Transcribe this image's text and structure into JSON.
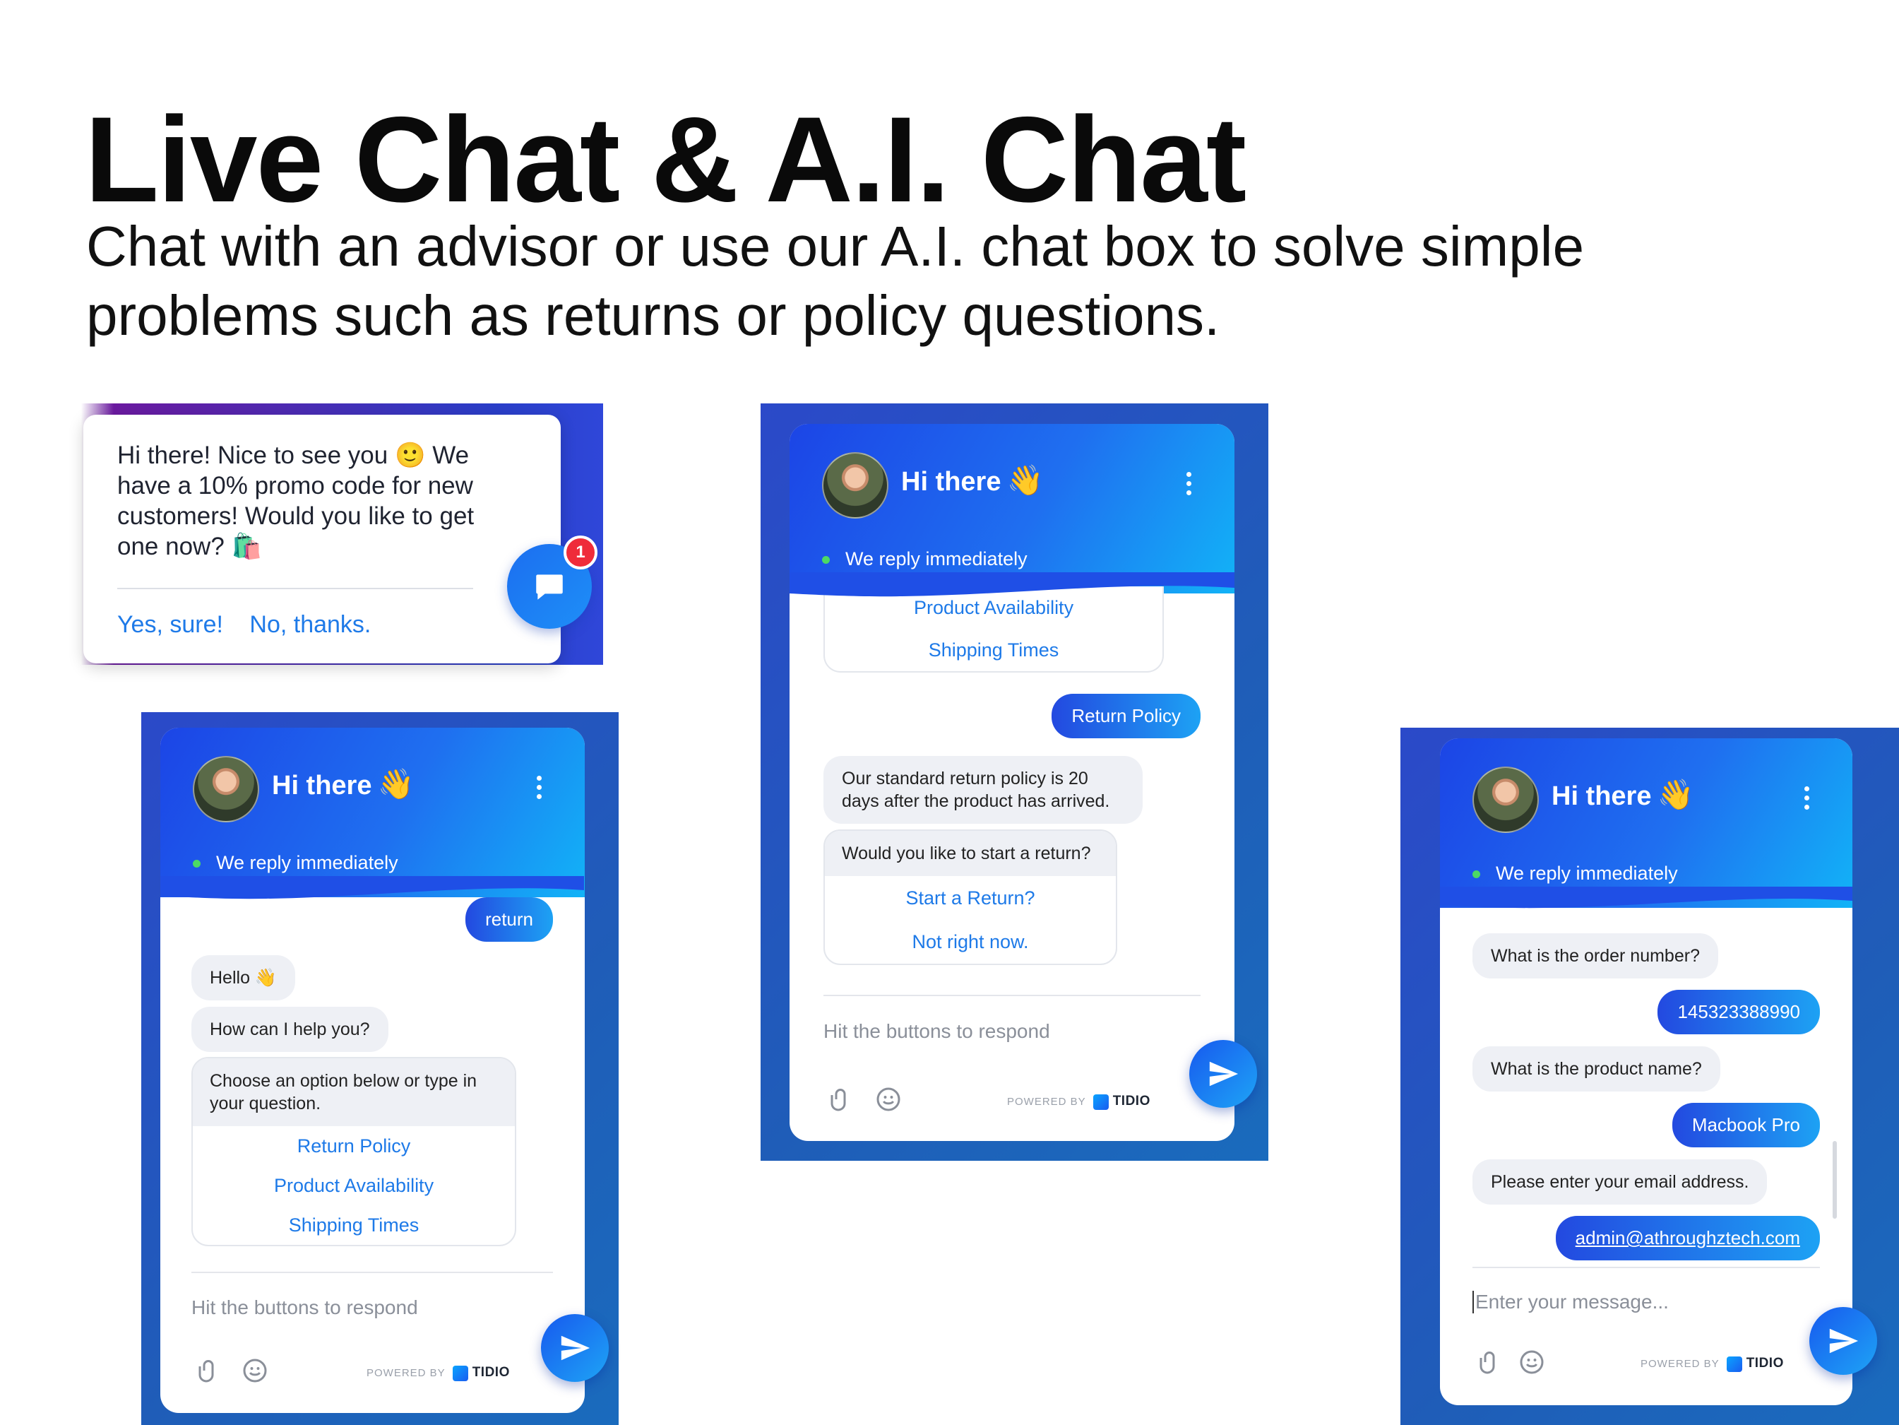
{
  "heading": {
    "title": "Live Chat & A.I. Chat",
    "subtitle": "Chat with an advisor or use our A.I. chat box to solve simple problems such as returns or policy questions."
  },
  "promo": {
    "message": "Hi there! Nice to see you 🙂 We have a 10% promo code for new customers! Would you like to get one now? 🛍️",
    "yes_label": "Yes, sure!",
    "no_label": "No, thanks.",
    "badge_count": "1"
  },
  "widget_common": {
    "greeting": "Hi there",
    "wave_emoji": "👋",
    "status": "We reply immediately",
    "powered_by": "POWERED BY",
    "brand": "TIDIO",
    "input_hint": "Hit the buttons to respond",
    "input_placeholder": "Enter your message..."
  },
  "chat_left": {
    "user_msg": "return",
    "bot_hello": "Hello 👋",
    "bot_help": "How can I help you?",
    "bot_choose": "Choose an option below or type in your question.",
    "options": [
      "Return Policy",
      "Product Availability",
      "Shipping Times"
    ]
  },
  "chat_middle": {
    "options_top": [
      "Product Availability",
      "Shipping Times"
    ],
    "user_msg": "Return Policy",
    "bot_policy": "Our standard return policy is 20 days after the product has arrived.",
    "bot_question": "Would you like to start a return?",
    "options_return": [
      "Start a Return?",
      "Not right now."
    ]
  },
  "chat_right": {
    "bot_order": "What is the order number?",
    "user_order": "145323388990",
    "bot_product": "What is the product name?",
    "user_product": "Macbook Pro",
    "bot_email": "Please enter your email address.",
    "user_email": "admin@athroughztech.com"
  },
  "colors": {
    "accent": "#1e7ae8",
    "header_start": "#1c45e6",
    "header_end": "#12b3f7",
    "panel_bg": "#2b49c9",
    "status_dot": "#4cd964",
    "badge": "#ef2b3a"
  },
  "icons": [
    "chat-bubble-icon",
    "menu-dots-icon",
    "paperclip-icon",
    "emoji-icon",
    "send-icon",
    "tidio-logo-icon"
  ]
}
